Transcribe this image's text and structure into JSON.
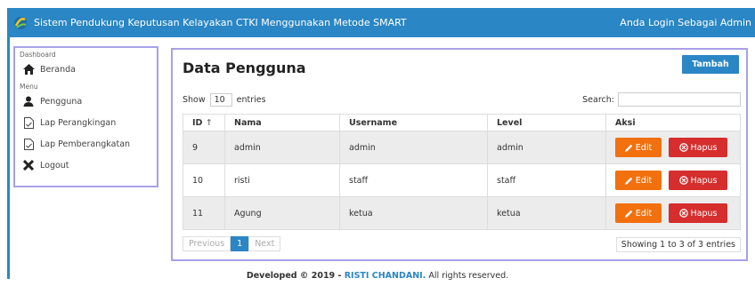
{
  "topbar": {
    "title": "Sistem Pendukung Keputusan Kelayakan CTKI Menggunakan Metode SMART",
    "login_info": "Anda Login Sebagai Admin"
  },
  "sidebar": {
    "dashboard_heading": "Dashboard",
    "menu_heading": "Menu",
    "items": [
      {
        "label": "Beranda",
        "icon": "home-icon"
      },
      {
        "label": "Pengguna",
        "icon": "user-icon"
      },
      {
        "label": "Lap Perangkingan",
        "icon": "report-icon"
      },
      {
        "label": "Lap Pemberangkatan",
        "icon": "report-icon"
      },
      {
        "label": "Logout",
        "icon": "close-icon"
      }
    ]
  },
  "panel": {
    "title": "Data Pengguna",
    "add_label": "Tambah",
    "show_label": "Show",
    "show_value": "10",
    "entries_label": "entries",
    "search_label": "Search:",
    "columns": [
      "ID",
      "Nama",
      "Username",
      "Level",
      "Aksi"
    ],
    "sort_indicator": "↑",
    "rows": [
      {
        "id": "9",
        "nama": "admin",
        "username": "admin",
        "level": "admin"
      },
      {
        "id": "10",
        "nama": "risti",
        "username": "staff",
        "level": "staff"
      },
      {
        "id": "11",
        "nama": "Agung",
        "username": "ketua",
        "level": "ketua"
      }
    ],
    "edit_label": "Edit",
    "delete_label": "Hapus",
    "pager": {
      "prev": "Previous",
      "current": "1",
      "next": "Next"
    },
    "info": "Showing 1 to 3 of 3 entries"
  },
  "footer": {
    "prefix": "Developed © 2019 - ",
    "author": "RISTI CHANDANI.",
    "suffix": " All rights reserved."
  },
  "colors": {
    "primary": "#2a86c4",
    "edit": "#f2700e",
    "delete": "#d62d2d",
    "border_accent": "#a7a1e8"
  }
}
